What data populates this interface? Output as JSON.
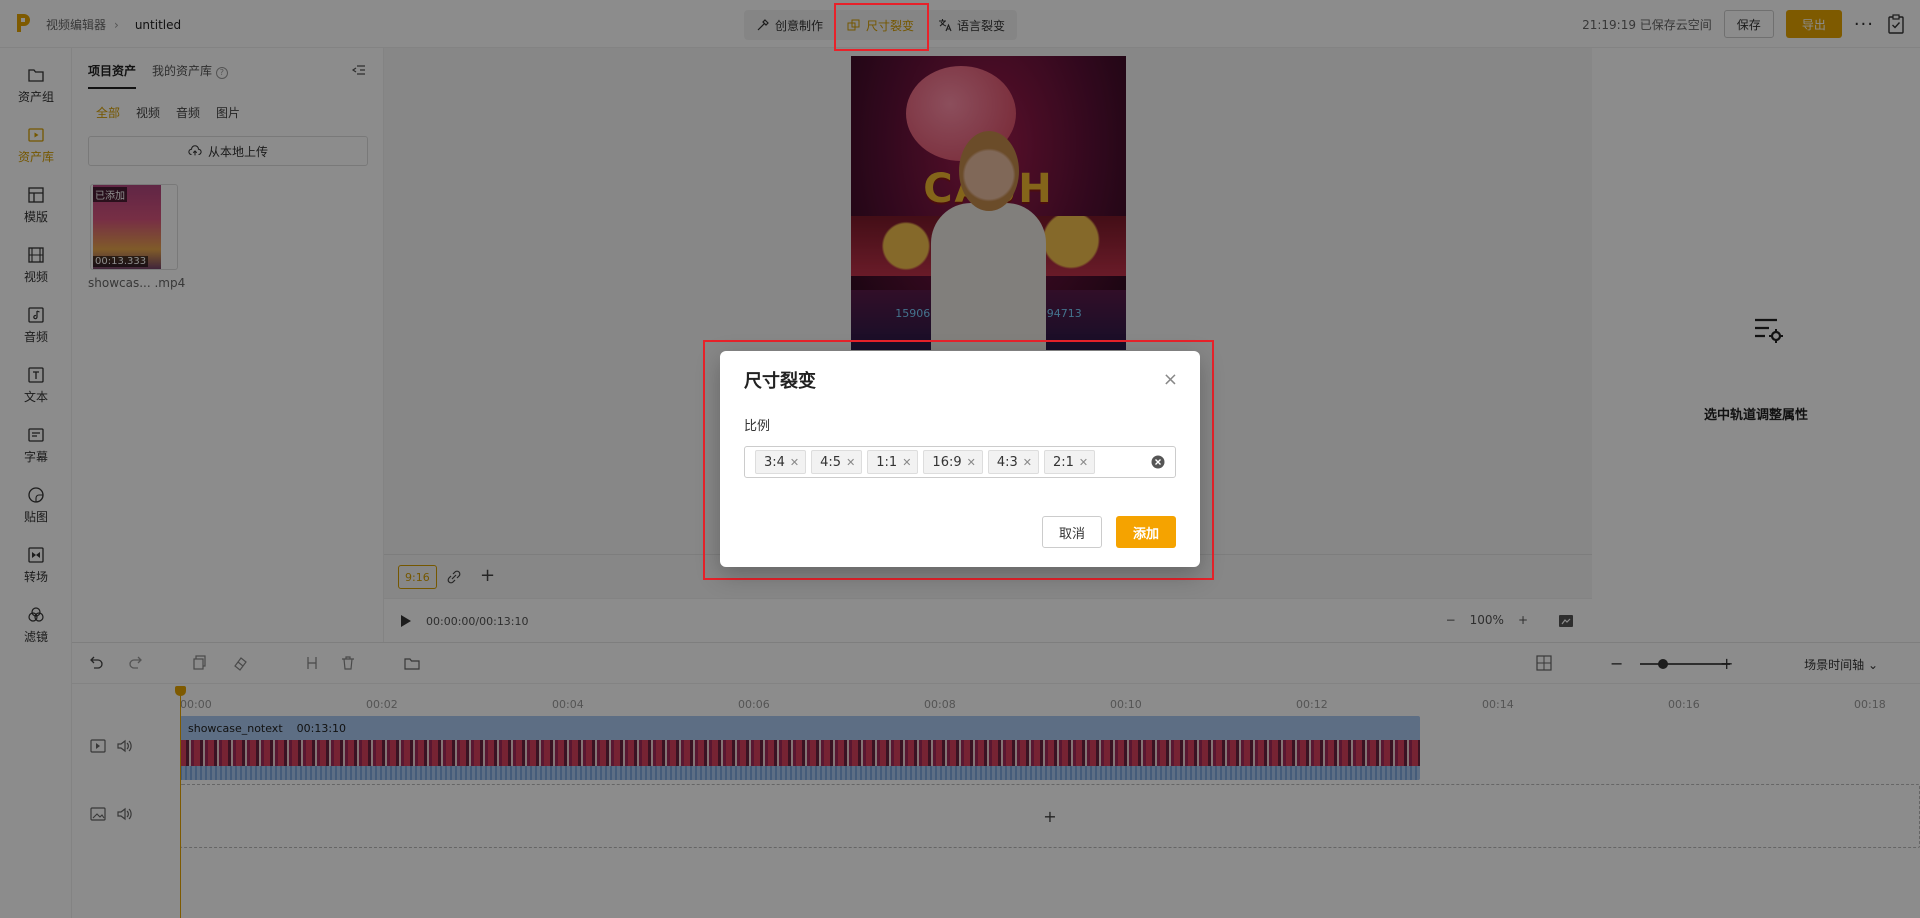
{
  "header": {
    "breadcrumb_root": "视频编辑器",
    "project_name": "untitled",
    "tabs": [
      {
        "label": "创意制作",
        "active": false
      },
      {
        "label": "尺寸裂变",
        "active": true
      },
      {
        "label": "语言裂变",
        "active": false
      }
    ],
    "save_status": "21:19:19 已保存云空间",
    "save_label": "保存",
    "export_label": "导出",
    "more_label": "···"
  },
  "sidebar": {
    "items": [
      {
        "label": "资产组",
        "icon": "folder-icon"
      },
      {
        "label": "资产库",
        "icon": "media-library-icon",
        "active": true
      },
      {
        "label": "模版",
        "icon": "template-icon"
      },
      {
        "label": "视频",
        "icon": "film-icon"
      },
      {
        "label": "音频",
        "icon": "music-note-icon"
      },
      {
        "label": "文本",
        "icon": "text-icon"
      },
      {
        "label": "字幕",
        "icon": "subtitle-icon"
      },
      {
        "label": "贴图",
        "icon": "sticker-icon"
      },
      {
        "label": "转场",
        "icon": "transition-icon"
      },
      {
        "label": "滤镜",
        "icon": "filter-icon"
      }
    ]
  },
  "assets": {
    "tabs": [
      "项目资产",
      "我的资产库"
    ],
    "filters": [
      "全部",
      "视频",
      "音频",
      "图片"
    ],
    "upload_label": "从本地上传",
    "item": {
      "badge": "已添加",
      "duration": "00:13.333",
      "name": "showcas... .mp4"
    }
  },
  "preview": {
    "video_text": "CASH",
    "video_score_left": "1590675",
    "video_score_right": "3194713",
    "ratio_chip": "9:16",
    "timecode": "00:00:00/00:13:10",
    "zoom": "100%"
  },
  "right_panel": {
    "hint": "选中轨道调整属性"
  },
  "timeline": {
    "scene_mode": "场景时间轴",
    "ticks": [
      "00:00",
      "00:02",
      "00:04",
      "00:06",
      "00:08",
      "00:10",
      "00:12",
      "00:14",
      "00:16",
      "00:18"
    ],
    "clip_name": "showcase_notext",
    "clip_duration": "00:13:10",
    "add_label": "+"
  },
  "modal": {
    "title": "尺寸裂变",
    "close": "×",
    "field_label": "比例",
    "selected_ratios": [
      "3:4",
      "4:5",
      "1:1",
      "16:9",
      "4:3",
      "2:1"
    ],
    "cancel_label": "取消",
    "ok_label": "添加"
  },
  "colors": {
    "accent": "#f5a300",
    "highlight": "#e8222a",
    "clip": "#a9c9f0"
  }
}
